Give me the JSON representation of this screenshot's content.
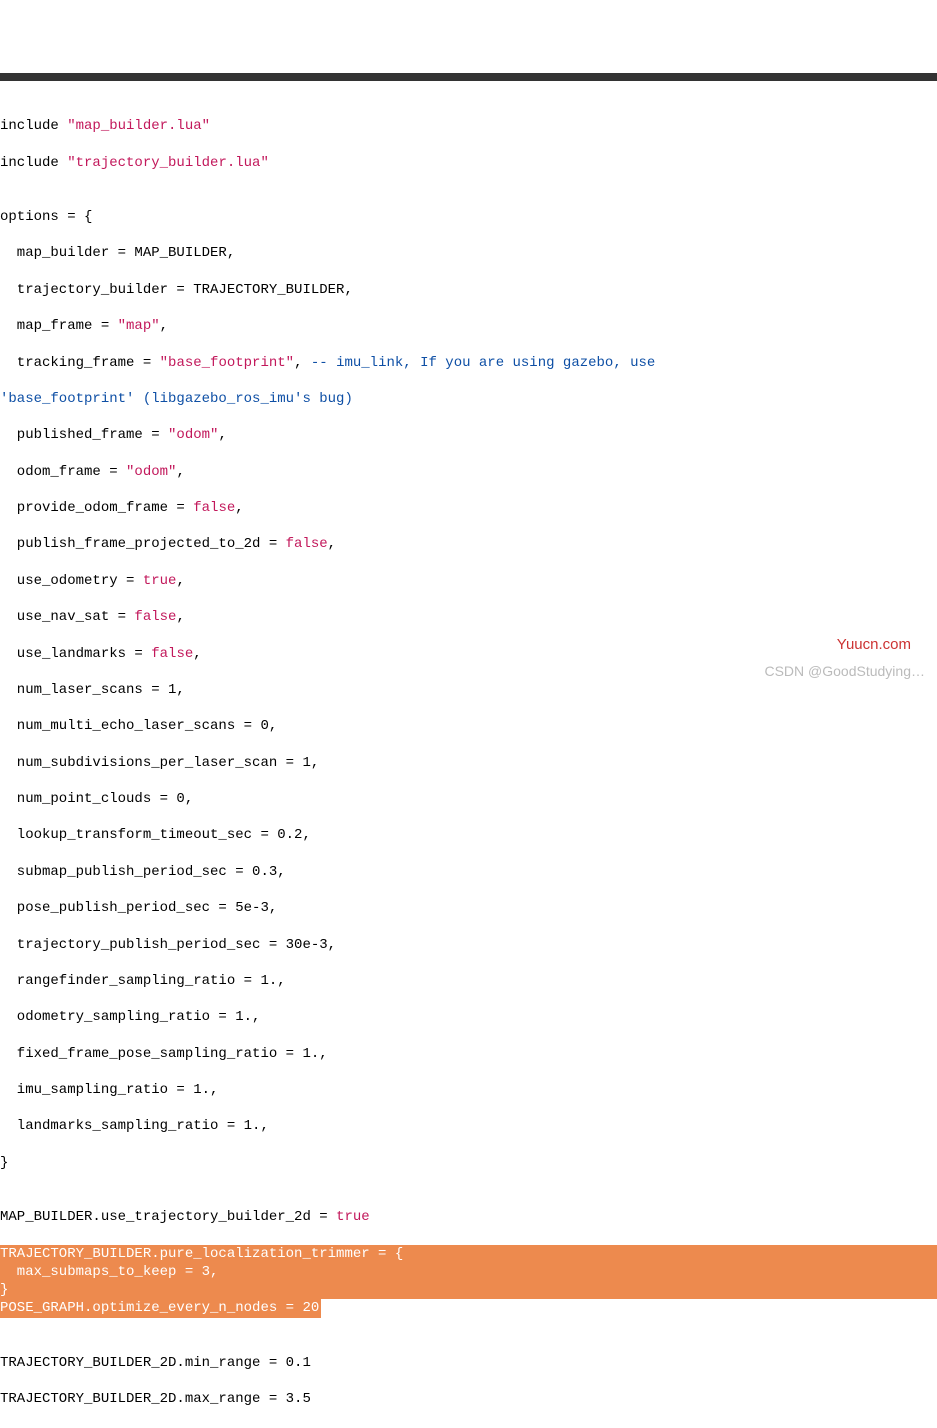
{
  "chart_data": {
    "type": "table",
    "title": "Cartographer Lua configuration (turtlebot)",
    "data": {
      "includes": [
        "map_builder.lua",
        "trajectory_builder.lua"
      ],
      "options": {
        "map_builder": "MAP_BUILDER",
        "trajectory_builder": "TRAJECTORY_BUILDER",
        "map_frame": "map",
        "tracking_frame": "base_footprint",
        "tracking_frame_comment": "imu_link, If you are using gazebo, use 'base_footprint' (libgazebo_ros_imu's bug)",
        "published_frame": "odom",
        "odom_frame": "odom",
        "provide_odom_frame": false,
        "publish_frame_projected_to_2d": false,
        "use_odometry": true,
        "use_nav_sat": false,
        "use_landmarks": false,
        "num_laser_scans": 1,
        "num_multi_echo_laser_scans": 0,
        "num_subdivisions_per_laser_scan": 1,
        "num_point_clouds": 0,
        "lookup_transform_timeout_sec": 0.2,
        "submap_publish_period_sec": 0.3,
        "pose_publish_period_sec": "5e-3",
        "trajectory_publish_period_sec": "30e-3",
        "rangefinder_sampling_ratio": 1.0,
        "odometry_sampling_ratio": 1.0,
        "fixed_frame_pose_sampling_ratio": 1.0,
        "imu_sampling_ratio": 1.0,
        "landmarks_sampling_ratio": 1.0
      },
      "post_options": {
        "MAP_BUILDER.use_trajectory_builder_2d": true,
        "TRAJECTORY_BUILDER.pure_localization_trimmer.max_submaps_to_keep": 3,
        "POSE_GRAPH.optimize_every_n_nodes": 20,
        "TRAJECTORY_BUILDER_2D.min_range": 0.1,
        "TRAJECTORY_BUILDER_2D.max_range": 3.5
      }
    }
  },
  "lines": {
    "l1a": "include ",
    "l1b": "\"map_builder.lua\"",
    "l2a": "include ",
    "l2b": "\"trajectory_builder.lua\"",
    "l3": "",
    "l4": "options = {",
    "l5": "  map_builder = MAP_BUILDER,",
    "l6": "  trajectory_builder = TRAJECTORY_BUILDER,",
    "l7a": "  map_frame = ",
    "l7b": "\"map\"",
    "l7c": ",",
    "l8a": "  tracking_frame = ",
    "l8b": "\"base_footprint\"",
    "l8c": ", ",
    "l8d": "-- imu_link, If you are using gazebo, use ",
    "l9": "'base_footprint' (libgazebo_ros_imu's bug)",
    "l10a": "  published_frame = ",
    "l10b": "\"odom\"",
    "l10c": ",",
    "l11a": "  odom_frame = ",
    "l11b": "\"odom\"",
    "l11c": ",",
    "l12a": "  provide_odom_frame = ",
    "l12b": "false",
    "l12c": ",",
    "l13a": "  publish_frame_projected_to_2d = ",
    "l13b": "false",
    "l13c": ",",
    "l14a": "  use_odometry = ",
    "l14b": "true",
    "l14c": ",",
    "l15a": "  use_nav_sat = ",
    "l15b": "false",
    "l15c": ",",
    "l16a": "  use_landmarks = ",
    "l16b": "false",
    "l16c": ",",
    "l17": "  num_laser_scans = 1,",
    "l18": "  num_multi_echo_laser_scans = 0,",
    "l19": "  num_subdivisions_per_laser_scan = 1,",
    "l20": "  num_point_clouds = 0,",
    "l21": "  lookup_transform_timeout_sec = 0.2,",
    "l22": "  submap_publish_period_sec = 0.3,",
    "l23": "  pose_publish_period_sec = 5e-3,",
    "l24": "  trajectory_publish_period_sec = 30e-3,",
    "l25": "  rangefinder_sampling_ratio = 1.,",
    "l26": "  odometry_sampling_ratio = 1.,",
    "l27": "  fixed_frame_pose_sampling_ratio = 1.,",
    "l28": "  imu_sampling_ratio = 1.,",
    "l29": "  landmarks_sampling_ratio = 1.,",
    "l30": "}",
    "l31": "",
    "l32a": "MAP_BUILDER.use_trajectory_builder_2d = ",
    "l32b": "true",
    "l33": "TRAJECTORY_BUILDER.pure_localization_trimmer = {",
    "l34": "  max_submaps_to_keep = 3,",
    "l35": "}",
    "l36": "POSE_GRAPH.optimize_every_n_nodes = 20",
    "l37": "",
    "l38": "TRAJECTORY_BUILDER_2D.min_range = 0.1",
    "l39": "TRAJECTORY_BUILDER_2D.max_range = 3.5"
  },
  "watermark1": "Yuucn.com",
  "watermark2": "CSDN @GoodStudying…"
}
